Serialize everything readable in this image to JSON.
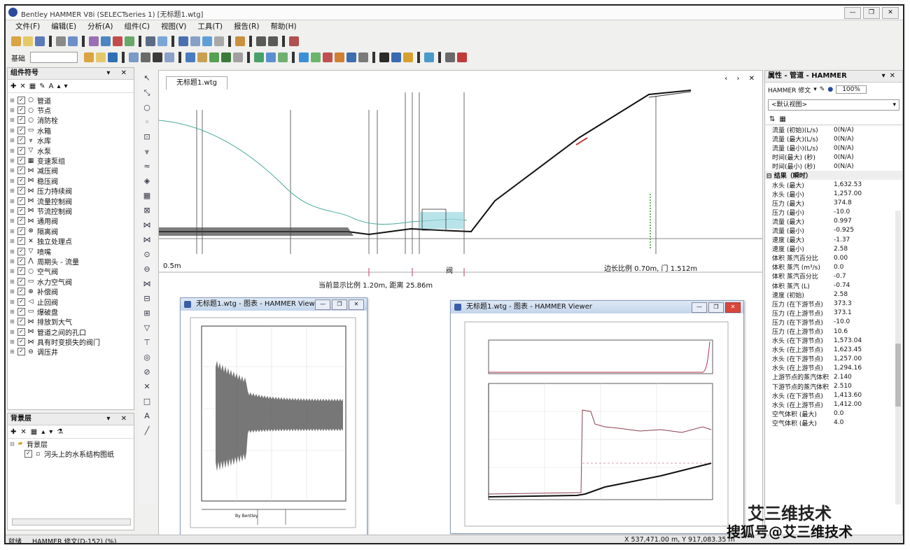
{
  "window": {
    "title": "Bentley HAMMER V8i (SELECTseries 1) [无标题1.wtg]",
    "controls": [
      "—",
      "❐",
      "✕"
    ]
  },
  "menu": [
    "文件(F)",
    "编辑(E)",
    "分析(A)",
    "组件(C)",
    "视图(V)",
    "工具(T)",
    "报告(R)",
    "帮助(H)"
  ],
  "toolbar3_label": "基础",
  "element_panel": {
    "title": "组件符号",
    "controls": "▾ ✕",
    "items": [
      {
        "label": "管道",
        "icon": "○"
      },
      {
        "label": "节点",
        "icon": "○"
      },
      {
        "label": "消防栓",
        "icon": "○"
      },
      {
        "label": "水箱",
        "icon": "▭"
      },
      {
        "label": "水库",
        "icon": "⩔"
      },
      {
        "label": "水泵",
        "icon": "▽"
      },
      {
        "label": "变速泵组",
        "icon": "▦"
      },
      {
        "label": "减压阀",
        "icon": "⋈"
      },
      {
        "label": "稳压阀",
        "icon": "⋈"
      },
      {
        "label": "压力持续阀",
        "icon": "⋈"
      },
      {
        "label": "流量控制阀",
        "icon": "⋈"
      },
      {
        "label": "节流控制阀",
        "icon": "⋈"
      },
      {
        "label": "通用阀",
        "icon": "⋈"
      },
      {
        "label": "隔离阀",
        "icon": "⊗"
      },
      {
        "label": "独立处理点",
        "icon": "✕"
      },
      {
        "label": "喷嘴",
        "icon": "▽"
      },
      {
        "label": "周期头 - 流量",
        "icon": "⋀"
      },
      {
        "label": "空气阀",
        "icon": "○"
      },
      {
        "label": "水力空气阀",
        "icon": "▭"
      },
      {
        "label": "补偿阀",
        "icon": "⊕"
      },
      {
        "label": "止回阀",
        "icon": "◁"
      },
      {
        "label": "爆破盘",
        "icon": "▭"
      },
      {
        "label": "排放到大气",
        "icon": "⋈"
      },
      {
        "label": "管道之间的孔口",
        "icon": "⋈"
      },
      {
        "label": "具有时变损失的阀门",
        "icon": "⋈"
      },
      {
        "label": "调压井",
        "icon": "⊖"
      }
    ]
  },
  "background_panel": {
    "title": "背景层",
    "controls": "▾ ✕",
    "root": "背景层",
    "child": "河头上的水系结构图纸"
  },
  "document": {
    "tab": "无标题1.wtg",
    "controls": "‹ › ✕",
    "scale_left": "0.5m",
    "annotation_right": "边长比例 0.70m, 门 1.512m",
    "annotation_bottom": "当前显示比例 1.20m, 距离 25.86m",
    "label_mid": "阀",
    "profile_color": "#111111",
    "hgl_color": "#4aa89a"
  },
  "graph_window_1": {
    "title": "无标题1.wtg - 图表 - HAMMER Viewer",
    "footer": "By Bentley"
  },
  "graph_window_2": {
    "title": "无标题1.wtg - 图表 - HAMMER Viewer"
  },
  "properties_panel": {
    "title": "属性 - 管道 - HAMMER",
    "selector": "HAMMER 修文",
    "zoom": "100%",
    "dropdown": "<默认视图>",
    "section": "结果（瞬时）",
    "rows_top": [
      {
        "name": "流量 (初始)(L/s)",
        "value": "0(N/A)"
      },
      {
        "name": "流量 (最大)(L/s)",
        "value": "0(N/A)"
      },
      {
        "name": "流量 (最小)(L/s)",
        "value": "0(N/A)"
      },
      {
        "name": "时间(最大) (秒)",
        "value": "0(N/A)"
      },
      {
        "name": "时间(最小) (秒)",
        "value": "0(N/A)"
      }
    ],
    "rows": [
      {
        "name": "水头 (最大)",
        "value": "1,632.53"
      },
      {
        "name": "水头 (最小)",
        "value": "1,257.00"
      },
      {
        "name": "压力 (最大)",
        "value": "374.8"
      },
      {
        "name": "压力 (最小)",
        "value": "-10.0"
      },
      {
        "name": "流量 (最大)",
        "value": "0.997"
      },
      {
        "name": "流量 (最小)",
        "value": "-0.925"
      },
      {
        "name": "速度 (最大)",
        "value": "-1.37"
      },
      {
        "name": "速度 (最小)",
        "value": "2.58"
      },
      {
        "name": "体积 蒸汽百分比",
        "value": "0.00"
      },
      {
        "name": "体积 蒸汽 (m³/s)",
        "value": "0.0"
      },
      {
        "name": "体积 蒸汽百分比",
        "value": "-0.7"
      },
      {
        "name": "体积 蒸汽 (L)",
        "value": "-0.74"
      },
      {
        "name": "速度 (初始)",
        "value": "2.58"
      },
      {
        "name": "压力 (在下游节点)",
        "value": "373.3"
      },
      {
        "name": "压力 (在上游节点)",
        "value": "373.1"
      },
      {
        "name": "压力 (在下游节点)",
        "value": "-10.0"
      },
      {
        "name": "压力 (在上游节点)",
        "value": "10.6"
      },
      {
        "name": "水头 (在下游节点)",
        "value": "1,573.04"
      },
      {
        "name": "水头 (在上游节点)",
        "value": "1,623.45"
      },
      {
        "name": "水头 (在下游节点)",
        "value": "1,257.00"
      },
      {
        "name": "水头 (在上游节点)",
        "value": "1,294.16"
      },
      {
        "name": "上游节点的蒸汽体积",
        "value": "2.140"
      },
      {
        "name": "下游节点的蒸汽体积",
        "value": "2.510"
      },
      {
        "name": "水头 (在下游节点)",
        "value": "1,413.60"
      },
      {
        "name": "水头 (在上游节点)",
        "value": "1,412.00"
      },
      {
        "name": "空气体积 (最大)",
        "value": "0.0"
      },
      {
        "name": "空气体积 (最大)",
        "value": "4.0"
      }
    ]
  },
  "status": {
    "left": "就绪",
    "mid": "HAMMER 修文(D-152) (%)",
    "right": "X 537,471.00 m, Y 917,083.35 m"
  },
  "watermark": {
    "brand": "艾三维技术",
    "source": "搜狐号@艾三维技术"
  }
}
